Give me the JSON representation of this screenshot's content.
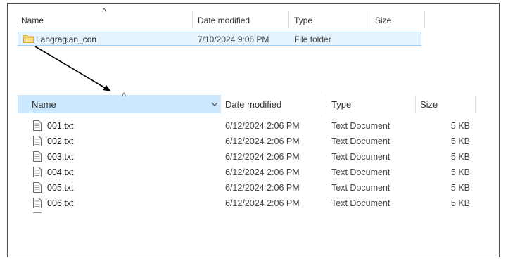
{
  "outer": {
    "columns": {
      "name": "Name",
      "date_modified": "Date modified",
      "type": "Type",
      "size": "Size"
    },
    "sort_indicator": "^",
    "folder": {
      "name": "Langragian_con",
      "date_modified": "7/10/2024 9:06 PM",
      "type": "File folder",
      "icon": "folder-icon"
    }
  },
  "inner": {
    "columns": {
      "name": "Name",
      "date_modified": "Date modified",
      "type": "Type",
      "size": "Size"
    },
    "sort_indicator": "^",
    "dropdown_icon": "chevron-down-icon",
    "files": [
      {
        "name": "001.txt",
        "date_modified": "6/12/2024 2:06 PM",
        "type": "Text Document",
        "size": "5 KB",
        "icon": "text-file-icon"
      },
      {
        "name": "002.txt",
        "date_modified": "6/12/2024 2:06 PM",
        "type": "Text Document",
        "size": "5 KB",
        "icon": "text-file-icon"
      },
      {
        "name": "003.txt",
        "date_modified": "6/12/2024 2:06 PM",
        "type": "Text Document",
        "size": "5 KB",
        "icon": "text-file-icon"
      },
      {
        "name": "004.txt",
        "date_modified": "6/12/2024 2:06 PM",
        "type": "Text Document",
        "size": "5 KB",
        "icon": "text-file-icon"
      },
      {
        "name": "005.txt",
        "date_modified": "6/12/2024 2:06 PM",
        "type": "Text Document",
        "size": "5 KB",
        "icon": "text-file-icon"
      },
      {
        "name": "006.txt",
        "date_modified": "6/12/2024 2:06 PM",
        "type": "Text Document",
        "size": "5 KB",
        "icon": "text-file-icon"
      }
    ]
  },
  "colors": {
    "selected_row_bg": "#e5f3ff",
    "selected_row_border": "#99d1ff",
    "sorted_header_bg": "#cce8ff",
    "folder_yellow": "#f8d775",
    "arrow": "#000000"
  }
}
